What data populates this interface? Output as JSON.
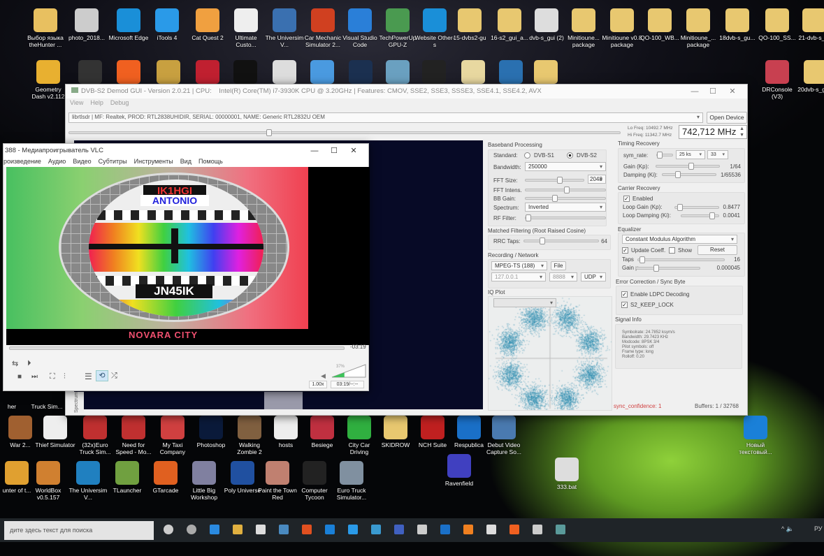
{
  "desktop": {
    "row1": [
      "Выбор языка theHunter ...",
      "photo_2018...",
      "Microsoft Edge",
      "iTools 4",
      "Cat Quest 2",
      "Ultimate Custo...",
      "The Universim V...",
      "Car Mechanic Simulator 2...",
      "Visual Studio Code",
      "TechPowerUp GPU-Z",
      "Website Other-s",
      "15-dvbs2-gu",
      "16-s2_gui_a...",
      "dvb-s_gui (2)",
      "Minitioune... package",
      "Minitioune v0.8 package",
      "QO-100_WB...",
      "Minitioune_... package",
      "18dvb-s_gu...",
      "QO-100_SS...",
      "21-dvb-s_..."
    ],
    "row2": [
      "Geometry Dash v2.112",
      "DRConsole (V3)",
      "20dvb-s_gu..."
    ],
    "row_mid": [
      "her",
      "Truck Sim..."
    ],
    "row3": [
      "War 2...",
      "Thief Simulator",
      "(32x)Euro Truck Sim...",
      "Need for Speed - Mo...",
      "My Taxi Company",
      "Photoshop",
      "Walking Zombie 2",
      "hosts",
      "Besiege",
      "City Car Driving",
      "SKIDROW",
      "NCH Suite",
      "Respublica",
      "Debut Video Capture So...",
      "Новый текстовый..."
    ],
    "row4": [
      "unter of t...",
      "WorldBox v0.5.157",
      "The Universim V...",
      "TLauncher",
      "GTarcade",
      "Little Big Workshop",
      "Poly Universe",
      "Paint the Town Red",
      "Computer Tycoon",
      "Euro Truck Simulator...",
      "Ravenfield",
      "333.bat"
    ]
  },
  "dvb": {
    "title": "DVB-S2 Demod GUI - Version 2.0.21 | CPU:",
    "cpu": "Intel(R) Core(TM) i7-3930K CPU @ 3.20GHz | Features: CMOV, SSE2, SSE3, SSSE3, SSE4.1, SSE4.2, AVX",
    "menu": [
      "View",
      "Help",
      "Debug"
    ],
    "device": "librtlsdr | MF: Realtek, PROD: RTL2838UHIDIR, SERIAL: 00000001, NAME: Generic RTL2832U OEM",
    "open_device": "Open Device",
    "lo_freq": "Lo Freq: 10492.7 MHz",
    "hi_freq": "Hi Freq: 11342.7 MHz",
    "frequency": "742,712 MHz",
    "spectrum_tab": "Spectrum",
    "baseband": {
      "title": "Baseband Processing",
      "standard_label": "Standard:",
      "s1": "DVB-S1",
      "s2": "DVB-S2",
      "bandwidth_label": "Bandwidth:",
      "bandwidth": "250000",
      "fft_size_label": "FFT Size:",
      "fft_size": "2048",
      "fft_intens_label": "FFT Intens.",
      "bb_gain_label": "BB Gain:",
      "spectrum_label": "Spectrum:",
      "spectrum": "Inverted",
      "rf_filter_label": "RF Filter:"
    },
    "matched": {
      "title": "Matched Filtering (Root Raised Cosine)",
      "rrc_label": "RRC Taps:",
      "rrc": "64"
    },
    "recording": {
      "title": "Recording / Network",
      "format": "MPEG-TS (188)",
      "file": "File",
      "ip": "127.0.0.1",
      "port": "8888",
      "proto": "UDP"
    },
    "iq": {
      "title": "IQ Plot"
    },
    "timing": {
      "title": "Timing Recovery",
      "sym_label": "sym_rate:",
      "sym": "25 ks",
      "sym2": "33",
      "gain_label": "Gain (Kp):",
      "gain": "1/64",
      "damp_label": "Damping (Ki):",
      "damp": "1/65536"
    },
    "carrier": {
      "title": "Carrier Recovery",
      "enabled": "Enabled",
      "lg_label": "Loop Gain (Kp):",
      "lg": "0.8477",
      "ld_label": "Loop Damping (Ki):",
      "ld": "0.0041"
    },
    "equalizer": {
      "title": "Equalizer",
      "algo": "Constant Modulus Algorithm",
      "update": "Update Coeff.",
      "show": "Show",
      "reset": "Reset",
      "taps_label": "Taps",
      "taps": "16",
      "gain_label": "Gain µ",
      "gain": "0.000045"
    },
    "fec": {
      "title": "Error Correction / Sync Byte",
      "ldpc": "Enable LDPC Decoding",
      "keep": "S2_KEEP_LOCK"
    },
    "signal": {
      "title": "Signal Info",
      "lines": [
        "Symbolrate: 24.7852 ksym/s",
        "Bandwidth: 29.7423 KHz",
        "Modcode: 8PSK 3/4",
        "Pilot symbols: off",
        "Frame type: long",
        "Rolloff: 0.20"
      ]
    },
    "sync": "sync_confidence: 1",
    "buffers": "Buffers: 1 / 32768"
  },
  "vlc": {
    "title": "388 - Медиапроигрыватель VLC",
    "menu": [
      "роизведение",
      "Аудио",
      "Видео",
      "Субтитры",
      "Инструменты",
      "Вид",
      "Помощь"
    ],
    "card": {
      "call": "IK1HGI",
      "name": "ANTONIO",
      "locator": "JN45IK",
      "city": "NOVARA CITY"
    },
    "remaining": "-03:19",
    "speed": "1.00x",
    "time": "03:19/--:--",
    "volume": "37%",
    "volume_level": 0.37
  },
  "taskbar": {
    "search": "дите здесь текст для поиска",
    "lang": "РУ"
  },
  "colors": {
    "accent": "#1e88d8",
    "sync": "#d04040",
    "iq": "#2a8bb0"
  }
}
